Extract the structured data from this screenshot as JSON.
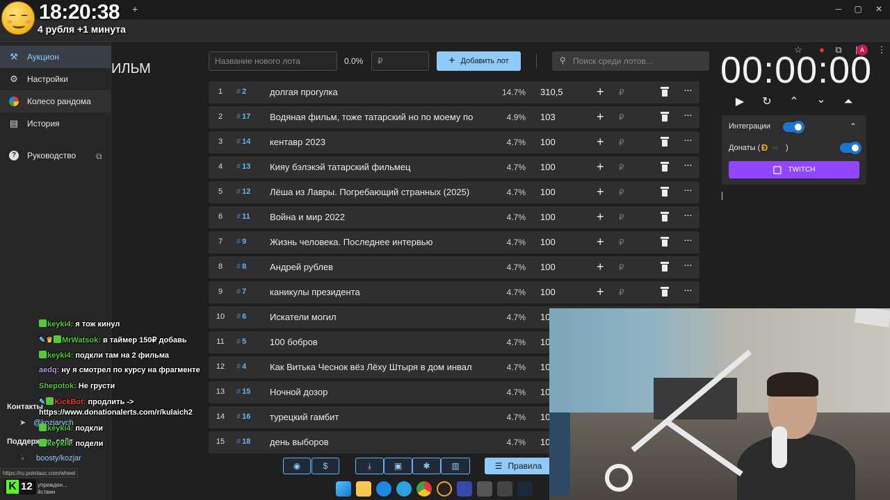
{
  "overlay": {
    "clock": "18:20:38",
    "subtitle": "4 рубля +1 минута"
  },
  "browser": {
    "new_tab": "+",
    "min": "─",
    "max": "▢",
    "close": "✕",
    "profile": "A"
  },
  "sidebar": {
    "items": [
      {
        "label": "Аукцион",
        "icon": "gavel-icon"
      },
      {
        "label": "Настройки",
        "icon": "gear-icon"
      },
      {
        "label": "Колесо рандома",
        "icon": "wheel-icon"
      },
      {
        "label": "История",
        "icon": "history-icon"
      },
      {
        "label": "Руководство",
        "icon": "help-icon"
      }
    ],
    "contacts_label": "Контакты",
    "telegram": "@kozjarych",
    "support_label": "Поддержать сайт",
    "boosty": "boosty/kozjar",
    "status_url": "https://ru.pointauc.com/wheel"
  },
  "page_heading": "ИЛЬМ",
  "controls": {
    "lot_name_placeholder": "Название нового лота",
    "percent": "0.0%",
    "price_placeholder": "₽",
    "add_lot": "Добавить лот",
    "search_placeholder": "Поиск среди лотов..."
  },
  "timer": {
    "value": "00:00:00"
  },
  "integrations": {
    "label": "Интеграции",
    "donations_label": "Донаты (",
    "donations_close": ")",
    "twitch": "TWITCH"
  },
  "lots": [
    {
      "num": "1",
      "id": "2",
      "name": "долгая прогулка",
      "pct": "14.7%",
      "amount": "310,5"
    },
    {
      "num": "2",
      "id": "17",
      "name": "Водяная фильм, тоже татарский но по моему по",
      "pct": "4.9%",
      "amount": "103"
    },
    {
      "num": "3",
      "id": "14",
      "name": "кентавр 2023",
      "pct": "4.7%",
      "amount": "100"
    },
    {
      "num": "4",
      "id": "13",
      "name": "Кияу бэлэкэй татарский фильмец",
      "pct": "4.7%",
      "amount": "100"
    },
    {
      "num": "5",
      "id": "12",
      "name": "Лёша из Лавры. Погребающий странных (2025)",
      "pct": "4.7%",
      "amount": "100"
    },
    {
      "num": "6",
      "id": "11",
      "name": "Война и мир 2022",
      "pct": "4.7%",
      "amount": "100"
    },
    {
      "num": "7",
      "id": "9",
      "name": "Жизнь человека. Последнее интервью",
      "pct": "4.7%",
      "amount": "100"
    },
    {
      "num": "8",
      "id": "8",
      "name": "Андрей рублев",
      "pct": "4.7%",
      "amount": "100"
    },
    {
      "num": "9",
      "id": "7",
      "name": "каникулы президента",
      "pct": "4.7%",
      "amount": "100"
    },
    {
      "num": "10",
      "id": "6",
      "name": "Искатели могил",
      "pct": "4.7%",
      "amount": "10"
    },
    {
      "num": "11",
      "id": "5",
      "name": "100 бобров",
      "pct": "4.7%",
      "amount": "10"
    },
    {
      "num": "12",
      "id": "4",
      "name": "Как Витька Чеснок вёз Лёху Штыря в дом инвал",
      "pct": "4.7%",
      "amount": "10"
    },
    {
      "num": "13",
      "id": "15",
      "name": "Ночной дозор",
      "pct": "4.7%",
      "amount": "10"
    },
    {
      "num": "14",
      "id": "16",
      "name": "турецкий гамбит",
      "pct": "4.7%",
      "amount": "10"
    },
    {
      "num": "15",
      "id": "18",
      "name": "день выборов",
      "pct": "4.7%",
      "amount": "10"
    }
  ],
  "lot_row": {
    "hash": "#",
    "plus": "+",
    "rub": "₽",
    "more": "···"
  },
  "toolbar": {
    "github": "◉",
    "donate": "$",
    "download": "⤓",
    "save": "▣",
    "bug": "✱",
    "clear": "▥",
    "rules": "Правила"
  },
  "chat": [
    {
      "user": "keyki4:",
      "text": " я тож кинул",
      "color": "#53c93b"
    },
    {
      "user": "MrWatsok:",
      "text": " в таймер 150₽ добавь",
      "color": "#53c93b"
    },
    {
      "user": "keyki4:",
      "text": " подкли там на 2 фильма",
      "color": "#53c93b"
    },
    {
      "user": "aedq:",
      "text": " ну я смотрел по курсу на фрагменте",
      "color": "#b39ddb"
    },
    {
      "user": "Shepotok:",
      "text": " Не грусти",
      "color": "#53c93b"
    },
    {
      "user": "KickBot:",
      "text": " продлить ->",
      "color": "#e53935"
    },
    {
      "user": "",
      "text": "https://www.donationalerts.com/r/kulaich2",
      "color": "#ffffff"
    },
    {
      "user": "keyki4:",
      "text": " подкли",
      "color": "#53c93b"
    },
    {
      "user": "keyki4:",
      "text": " подели",
      "color": "#53c93b"
    }
  ],
  "taskbar": {
    "kick_count": "12",
    "notice_line1": "упрежден...",
    "notice_line2": "йствии"
  }
}
